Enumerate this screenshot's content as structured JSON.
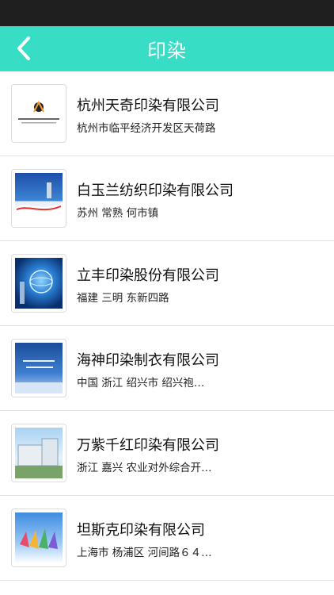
{
  "header": {
    "title": "印染",
    "back_icon": "chevron-left-icon",
    "background_color": "#37ddc5"
  },
  "companies": [
    {
      "name": "杭州天奇印染有限公司",
      "address": "杭州市临平经济开发区天荷路"
    },
    {
      "name": "白玉兰纺织印染有限公司",
      "address": "苏州 常熟 何市镇"
    },
    {
      "name": "立丰印染股份有限公司",
      "address": "福建 三明 东新四路"
    },
    {
      "name": "海神印染制衣有限公司",
      "address": "中国 浙江 绍兴市 绍兴袍江..."
    },
    {
      "name": "万紫千红印染有限公司",
      "address": "浙江 嘉兴 农业对外综合开发..."
    },
    {
      "name": "坦斯克印染有限公司",
      "address": "上海市 杨浦区 河间路６４０..."
    }
  ]
}
